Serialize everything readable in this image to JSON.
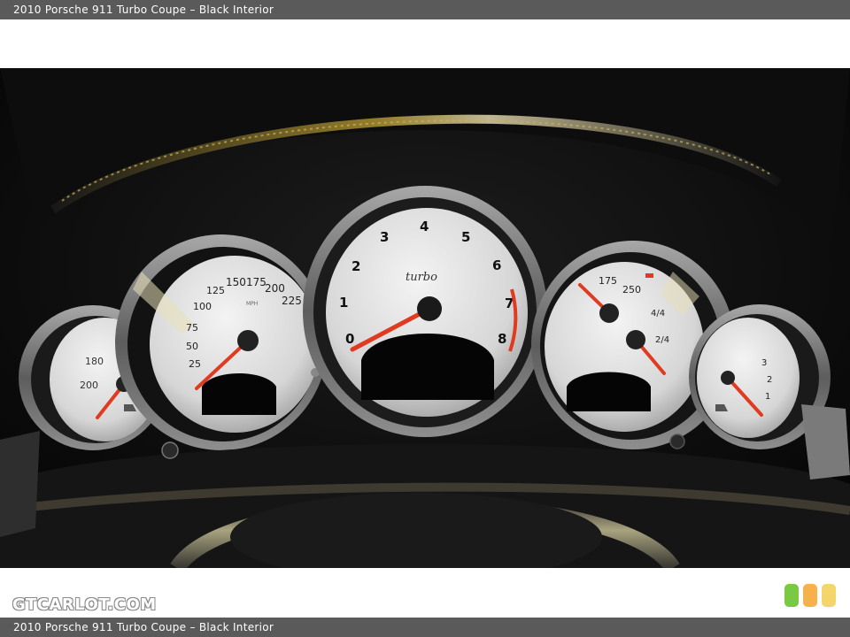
{
  "caption": {
    "title": "2010 Porsche 911 Turbo Coupe – Black Interior"
  },
  "watermark": {
    "text": "GTCARLOT.COM"
  },
  "badges": [
    {
      "color": "#7ac943"
    },
    {
      "color": "#f7b14a"
    },
    {
      "color": "#f4d56a"
    }
  ],
  "cluster": {
    "tach": {
      "brand_script": "turbo",
      "numbers": [
        "0",
        "1",
        "2",
        "3",
        "4",
        "5",
        "6",
        "7",
        "8"
      ]
    },
    "speedo": {
      "numbers": [
        "25",
        "50",
        "75",
        "100",
        "125",
        "150",
        "175",
        "200",
        "225"
      ],
      "unit": "MPH"
    },
    "right_gauge": {
      "numbers": [
        "175",
        "250",
        "4/4",
        "2/4"
      ]
    },
    "left_small": {
      "numbers": [
        "200",
        "180"
      ]
    },
    "right_small": {
      "numbers": [
        "3",
        "2",
        "1"
      ]
    }
  }
}
